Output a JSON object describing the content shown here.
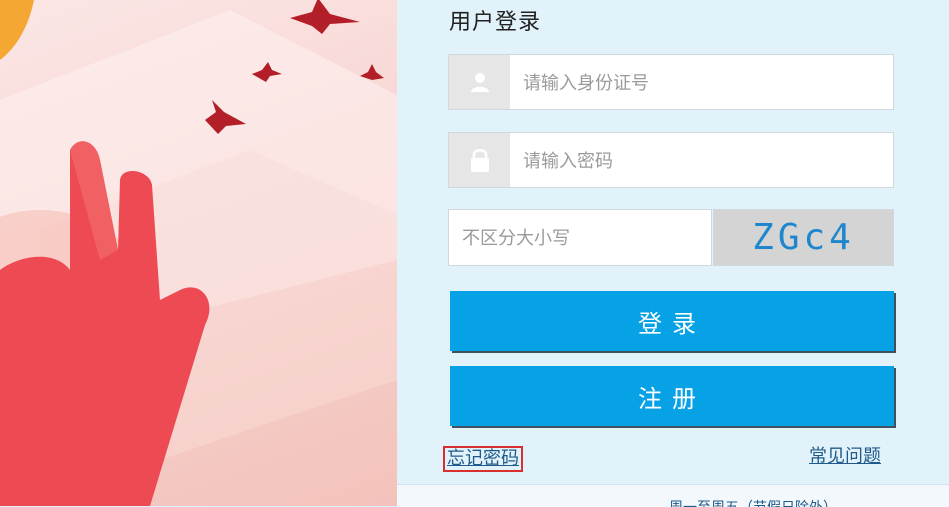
{
  "login": {
    "title": "用户登录",
    "id_placeholder": "请输入身份证号",
    "password_placeholder": "请输入密码",
    "captcha_placeholder": "不区分大小写",
    "captcha_text": "ZGc4",
    "login_button": "登录",
    "register_button": "注册",
    "forgot_link": "忘记密码",
    "faq_link": "常见问题"
  },
  "notice": {
    "text": "周一至周五（节假日除外）"
  },
  "colors": {
    "primary": "#07a2e6",
    "captcha_text": "#1e86cc",
    "link": "#1f5a8a",
    "highlight_border": "#d8302f"
  },
  "icons": [
    "user-icon",
    "lock-icon"
  ]
}
